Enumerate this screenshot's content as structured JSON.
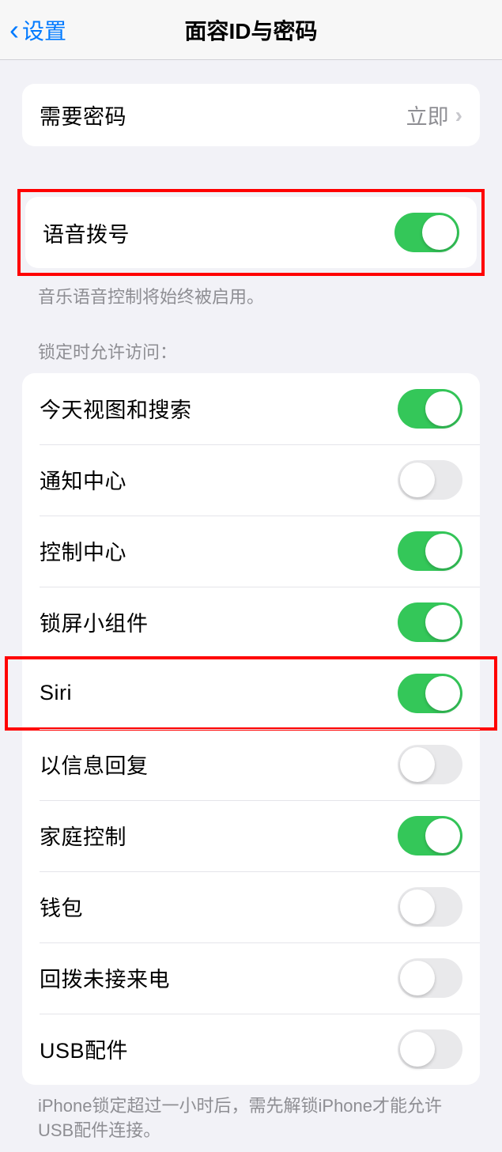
{
  "header": {
    "back_label": "设置",
    "title": "面容ID与密码"
  },
  "require_passcode": {
    "label": "需要密码",
    "value": "立即"
  },
  "voice_dial": {
    "label": "语音拨号",
    "enabled": true,
    "footer": "音乐语音控制将始终被启用。"
  },
  "locked_access": {
    "header": "锁定时允许访问：",
    "items": [
      {
        "label": "今天视图和搜索",
        "enabled": true
      },
      {
        "label": "通知中心",
        "enabled": false
      },
      {
        "label": "控制中心",
        "enabled": true
      },
      {
        "label": "锁屏小组件",
        "enabled": true
      },
      {
        "label": "Siri",
        "enabled": true,
        "highlighted": true
      },
      {
        "label": "以信息回复",
        "enabled": false
      },
      {
        "label": "家庭控制",
        "enabled": true
      },
      {
        "label": "钱包",
        "enabled": false
      },
      {
        "label": "回拨未接来电",
        "enabled": false
      },
      {
        "label": "USB配件",
        "enabled": false
      }
    ],
    "footer": "iPhone锁定超过一小时后，需先解锁iPhone才能允许USB配件连接。"
  }
}
